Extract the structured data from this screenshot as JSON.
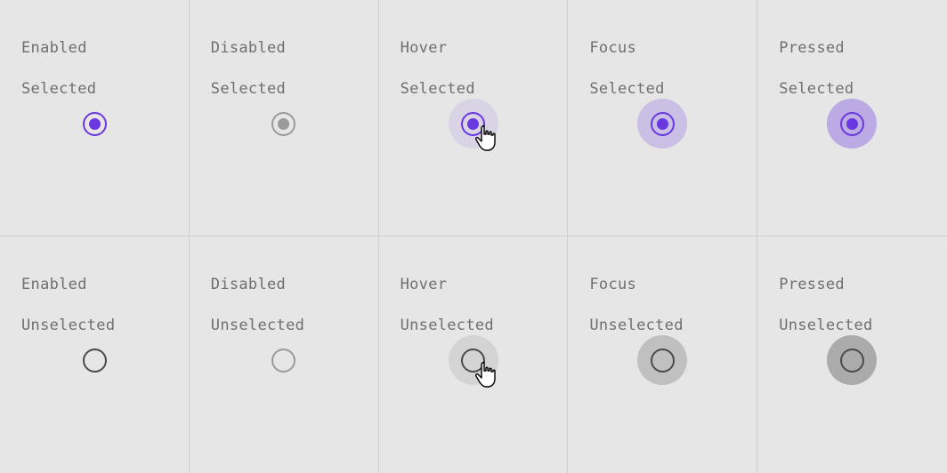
{
  "states": [
    {
      "line1": "Enabled",
      "line2": "Selected",
      "selected": true,
      "disabled": false,
      "halo": "",
      "cursor": false
    },
    {
      "line1": "Disabled",
      "line2": "Selected",
      "selected": true,
      "disabled": true,
      "halo": "",
      "cursor": false
    },
    {
      "line1": "Hover",
      "line2": "Selected",
      "selected": true,
      "disabled": false,
      "halo": "halo-hover-selected",
      "cursor": true
    },
    {
      "line1": "Focus",
      "line2": "Selected",
      "selected": true,
      "disabled": false,
      "halo": "halo-focus-selected",
      "cursor": false
    },
    {
      "line1": "Pressed",
      "line2": "Selected",
      "selected": true,
      "disabled": false,
      "halo": "halo-pressed-selected",
      "cursor": false
    },
    {
      "line1": "Enabled",
      "line2": "Unselected",
      "selected": false,
      "disabled": false,
      "halo": "",
      "cursor": false
    },
    {
      "line1": "Disabled",
      "line2": "Unselected",
      "selected": false,
      "disabled": true,
      "halo": "",
      "cursor": false
    },
    {
      "line1": "Hover",
      "line2": "Unselected",
      "selected": false,
      "disabled": false,
      "halo": "halo-hover-un",
      "cursor": true
    },
    {
      "line1": "Focus",
      "line2": "Unselected",
      "selected": false,
      "disabled": false,
      "halo": "halo-focus-un",
      "cursor": false
    },
    {
      "line1": "Pressed",
      "line2": "Unselected",
      "selected": false,
      "disabled": false,
      "halo": "halo-pressed-un",
      "cursor": false
    }
  ],
  "colors": {
    "primary": "#6a38e0",
    "text": "#6f6f6f",
    "ringDark": "#4a4a4a",
    "disabled": "#9a9a9a",
    "bg": "#e6e6e6",
    "border": "#cfcfcf"
  }
}
